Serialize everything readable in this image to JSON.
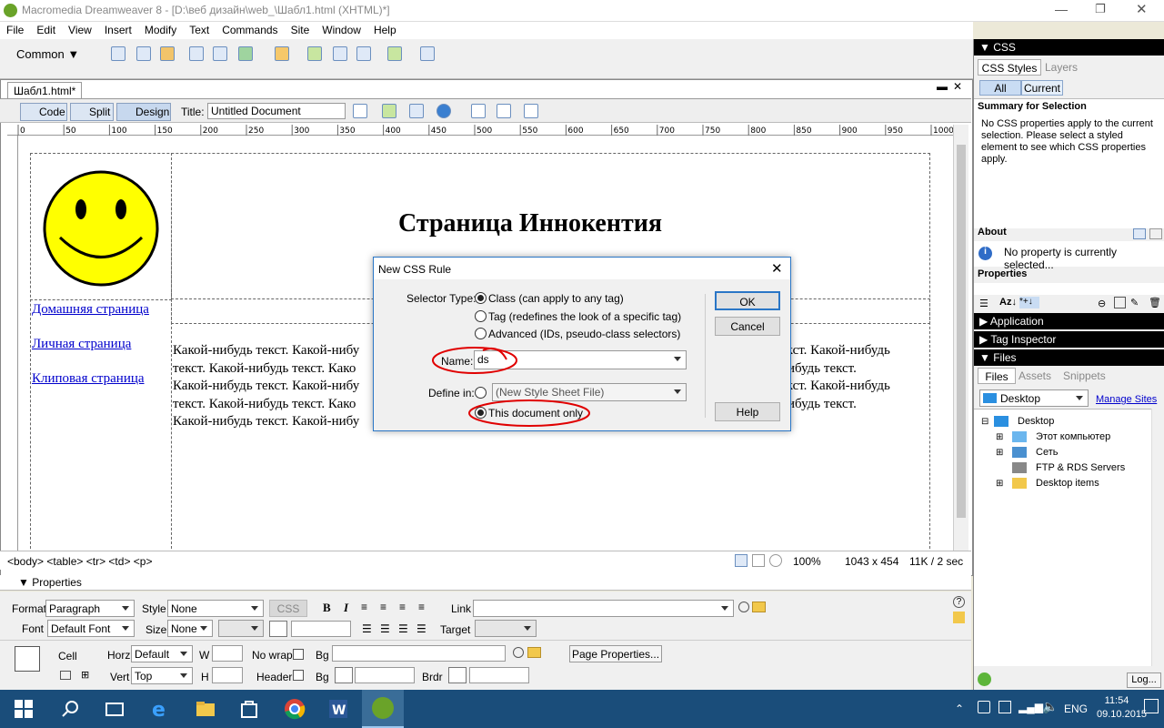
{
  "window": {
    "title": "Macromedia Dreamweaver 8 - [D:\\веб дизайн\\web_\\Шабл1.html (XHTML)*]"
  },
  "menu": [
    "File",
    "Edit",
    "View",
    "Insert",
    "Modify",
    "Text",
    "Commands",
    "Site",
    "Window",
    "Help"
  ],
  "insertbar": {
    "category": "Common"
  },
  "document": {
    "tab_label": "Шабл1.html*",
    "views": {
      "code": "Code",
      "split": "Split",
      "design": "Design"
    },
    "title_label": "Title:",
    "title_value": "Untitled Document",
    "ruler_ticks": [
      "0",
      "50",
      "100",
      "150",
      "200",
      "250",
      "300",
      "350",
      "400",
      "450",
      "500",
      "550",
      "600",
      "650",
      "700",
      "750",
      "800",
      "850",
      "900",
      "950",
      "1000"
    ],
    "page": {
      "heading": "Страница Иннокентия",
      "links": [
        "Домашняя страница",
        "Личная страница",
        "Клиповая страница"
      ],
      "body_text_left": [
        "Какой-нибудь текст. Какой-нибу",
        "текст. Какой-нибудь текст. Како",
        "Какой-нибудь текст. Какой-нибу",
        "текст. Какой-нибудь текст. Како",
        "Какой-нибудь текст. Какой-нибу"
      ],
      "body_text_right": [
        "екст. Какой-нибудь",
        "нибудь текст.",
        "екст. Какой-нибудь",
        "нибудь текст."
      ]
    }
  },
  "statusbar": {
    "tags": "<body> <table> <tr> <td> <p>",
    "zoom": "100%",
    "size": "1043 x 454",
    "weight": "11K / 2 sec"
  },
  "properties": {
    "header": "Properties",
    "format_label": "Format",
    "format_value": "Paragraph",
    "style_label": "Style",
    "style_value": "None",
    "css_btn": "CSS",
    "link_label": "Link",
    "font_label": "Font",
    "font_value": "Default Font",
    "size_label": "Size",
    "size_value": "None",
    "target_label": "Target",
    "cell_label": "Cell",
    "horz_label": "Horz",
    "horz_value": "Default",
    "w_label": "W",
    "nowrap_label": "No wrap",
    "bg_label": "Bg",
    "page_props_btn": "Page Properties...",
    "vert_label": "Vert",
    "vert_value": "Top",
    "h_label": "H",
    "header_label": "Header",
    "brdr_label": "Brdr"
  },
  "rightpanel": {
    "css_header": "CSS",
    "tabs": [
      "CSS Styles",
      "Layers"
    ],
    "subtabs": [
      "All",
      "Current"
    ],
    "summary_title": "Summary for Selection",
    "summary_text": "No CSS properties apply to the current selection.  Please select a styled element to see which CSS properties apply.",
    "about_title": "About",
    "about_text": "No property is currently selected...",
    "properties_title": "Properties",
    "application": "Application",
    "tag_inspector": "Tag Inspector",
    "files": "Files",
    "files_tabs": [
      "Files",
      "Assets",
      "Snippets"
    ],
    "site_value": "Desktop",
    "manage_sites": "Manage Sites",
    "tree": [
      "Desktop",
      "Этот компьютер",
      "Сеть",
      "FTP & RDS Servers",
      "Desktop items"
    ],
    "log_btn": "Log..."
  },
  "dialog": {
    "title": "New CSS Rule",
    "selector_label": "Selector Type:",
    "opt_class": "Class (can apply to any tag)",
    "opt_tag": "Tag (redefines the look of a specific tag)",
    "opt_adv": "Advanced (IDs, pseudo-class selectors)",
    "name_label": "Name:",
    "name_value": "ds",
    "define_label": "Define in:",
    "define_value": "(New Style Sheet File)",
    "define_doc": "This document only",
    "ok": "OK",
    "cancel": "Cancel",
    "help": "Help"
  },
  "taskbar": {
    "lang": "ENG",
    "time": "11:54",
    "date": "09.10.2015"
  },
  "colors": {
    "accent": "#2a76c6",
    "annotation": "#e00000",
    "taskbar": "#1a4d7a",
    "smiley": "#ffff00"
  }
}
